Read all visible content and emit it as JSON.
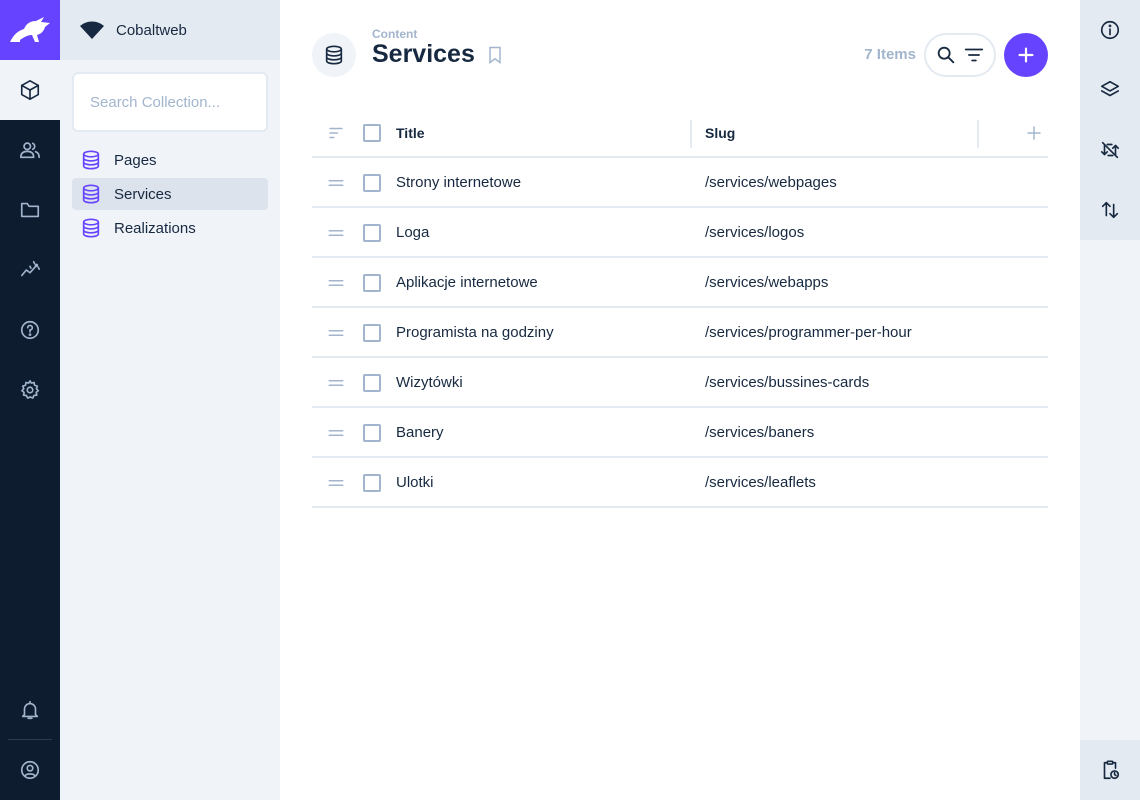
{
  "project": {
    "name": "Cobaltweb"
  },
  "modules": [
    {
      "name": "content-icon"
    },
    {
      "name": "users-icon"
    },
    {
      "name": "files-icon"
    },
    {
      "name": "insights-icon"
    },
    {
      "name": "help-icon"
    },
    {
      "name": "settings-icon"
    },
    {
      "name": "notifications-icon"
    },
    {
      "name": "user-account-icon"
    }
  ],
  "navigation": {
    "search_placeholder": "Search Collection...",
    "collections": [
      {
        "label": "Pages",
        "active": false
      },
      {
        "label": "Services",
        "active": true
      },
      {
        "label": "Realizations",
        "active": false
      }
    ]
  },
  "header": {
    "breadcrumb": "Content",
    "title": "Services",
    "item_count": "7 Items"
  },
  "table": {
    "columns": {
      "title": "Title",
      "slug": "Slug"
    },
    "rows": [
      {
        "title": "Strony internetowe",
        "slug": "/services/webpages"
      },
      {
        "title": "Loga",
        "slug": "/services/logos"
      },
      {
        "title": "Aplikacje internetowe",
        "slug": "/services/webapps"
      },
      {
        "title": "Programista na godziny",
        "slug": "/services/programmer-per-hour"
      },
      {
        "title": "Wizytówki",
        "slug": "/services/bussines-cards"
      },
      {
        "title": "Banery",
        "slug": "/services/baners"
      },
      {
        "title": "Ulotki",
        "slug": "/services/leaflets"
      }
    ]
  },
  "sidebar": [
    {
      "name": "info-icon"
    },
    {
      "name": "layout-icon"
    },
    {
      "name": "sync-disabled-icon"
    },
    {
      "name": "import-export-icon"
    },
    {
      "name": "activity-log-icon"
    }
  ],
  "colors": {
    "accent": "#6644ff",
    "module_bar": "#0e1c2f",
    "nav_background": "#f0f4f9",
    "text": "#172940",
    "muted": "#a2b5cd"
  }
}
